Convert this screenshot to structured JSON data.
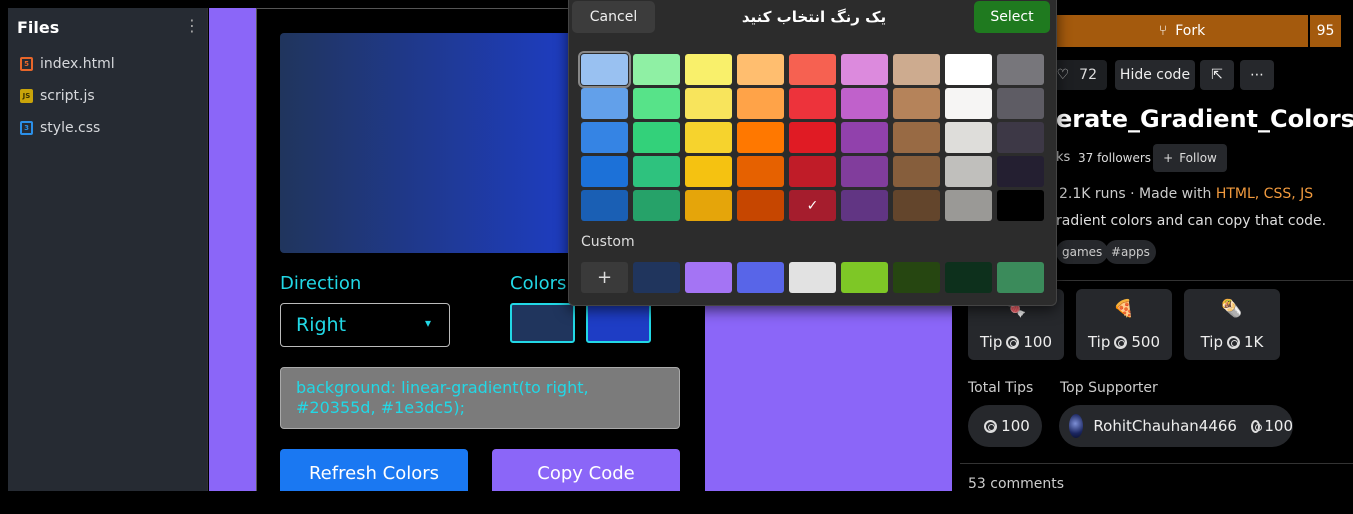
{
  "files_panel": {
    "title": "Files",
    "menu_icon": "vertical-dots-icon",
    "files": [
      {
        "name": "index.html",
        "icon": "html-file-icon"
      },
      {
        "name": "script.js",
        "icon": "js-file-icon"
      },
      {
        "name": "style.css",
        "icon": "css-file-icon"
      }
    ]
  },
  "preview": {
    "direction_label": "Direction",
    "direction_value": "Right",
    "colors_label": "Colors",
    "color1": "#20355d",
    "color2": "#1e3dc5",
    "code": "background: linear-gradient(to right, #20355d, #1e3dc5);",
    "refresh_label": "Refresh Colors",
    "copy_label": "Copy Code",
    "accent": "#22d8e6",
    "bg_purple": "#8b66f8"
  },
  "dialog": {
    "cancel_label": "Cancel",
    "title": "یک رنگ انتخاب کنید",
    "select_label": "Select",
    "custom_label": "Custom",
    "add_icon": "plus-icon",
    "check_icon": "checkmark-icon",
    "palette": [
      [
        "#99c1f1",
        "#8ff0a4",
        "#f9f06b",
        "#ffbe6f",
        "#f66151",
        "#dc8add",
        "#cdab8f",
        "#ffffff",
        "#77767b"
      ],
      [
        "#62a0ea",
        "#57e389",
        "#f8e45c",
        "#ffa348",
        "#ed333b",
        "#c061cb",
        "#b5835a",
        "#f6f5f4",
        "#5e5c64"
      ],
      [
        "#3584e4",
        "#33d17a",
        "#f6d32d",
        "#ff7800",
        "#e01b24",
        "#9141ac",
        "#986a44",
        "#deddda",
        "#3d3846"
      ],
      [
        "#1c71d8",
        "#2ec27e",
        "#f5c211",
        "#e66100",
        "#c01c28",
        "#813d9c",
        "#865e3c",
        "#c0bfbc",
        "#241f31"
      ],
      [
        "#1a5fb4",
        "#26a269",
        "#e5a50a",
        "#c64600",
        "#a51d2d",
        "#613583",
        "#63452c",
        "#9a9996",
        "#000000"
      ]
    ],
    "custom_colors": [
      "#20355d",
      "#a474f4",
      "#5865e8",
      "#e2e2e2",
      "#7ec726",
      "#264611",
      "#0d301c",
      "#3b8b5b"
    ]
  },
  "project": {
    "fork_label": "Fork",
    "fork_count": "95",
    "fork_icon": "fork-icon",
    "like_icon": "heart-icon",
    "likes": "72",
    "hide_code_label": "Hide code",
    "external_icon": "external-link-icon",
    "more_icon": "more-icon",
    "title": "erate_Gradient_Colors",
    "author_suffix": "ks",
    "followers": "37 followers",
    "follow_label": "Follow",
    "runs": "2.1K runs",
    "made_with_prefix": "· Made with",
    "made_with": "HTML, CSS, JS",
    "description": "radient colors and can copy that code.",
    "tags": [
      "games",
      "#apps"
    ],
    "tips": [
      {
        "emoji": "🍬",
        "label": "Tip",
        "amount": "100"
      },
      {
        "emoji": "🍕",
        "label": "Tip",
        "amount": "500"
      },
      {
        "emoji": "🌯",
        "label": "Tip",
        "amount": "1K"
      }
    ],
    "total_tips_label": "Total Tips",
    "total_tips": "100",
    "top_supporter_label": "Top Supporter",
    "top_supporter": "RohitChauhan4466",
    "top_supporter_amount": "100",
    "comments": "53 comments"
  }
}
